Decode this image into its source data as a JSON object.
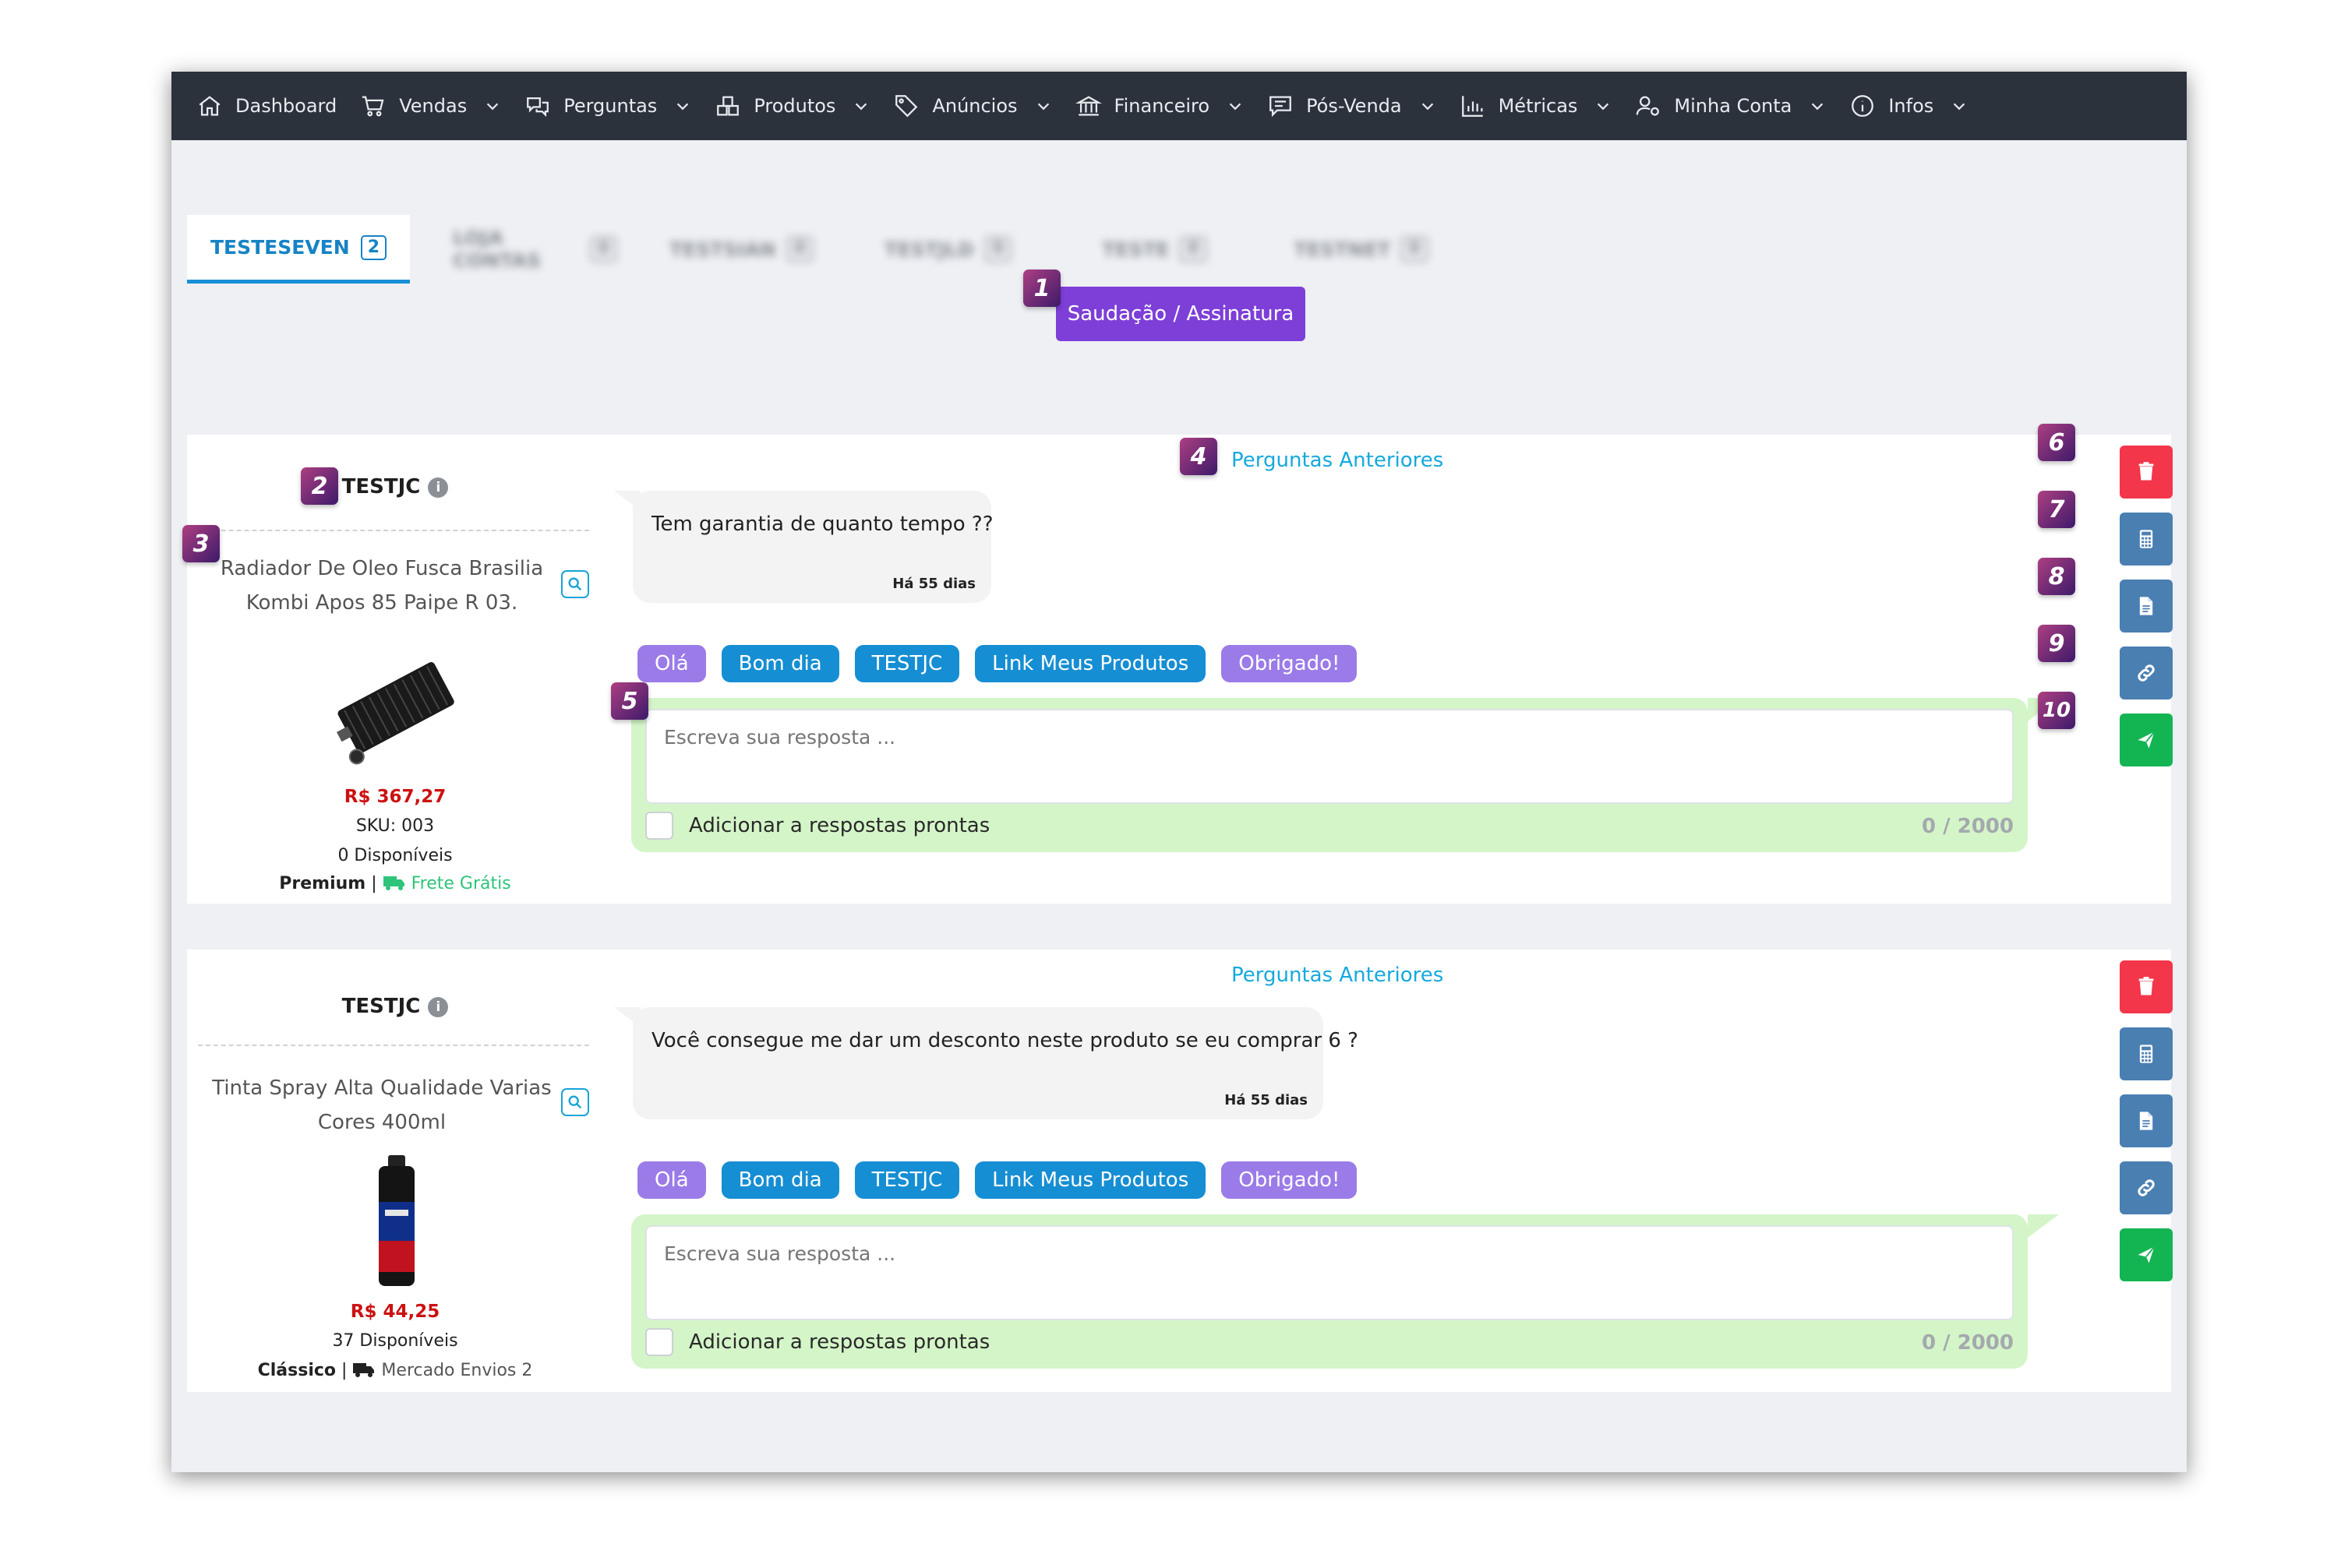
{
  "nav": [
    {
      "label": "Dashboard",
      "icon": "home-icon",
      "dropdown": false
    },
    {
      "label": "Vendas",
      "icon": "cart-icon",
      "dropdown": true
    },
    {
      "label": "Perguntas",
      "icon": "chat-icon",
      "dropdown": true
    },
    {
      "label": "Produtos",
      "icon": "boxes-icon",
      "dropdown": true
    },
    {
      "label": "Anúncios",
      "icon": "tag-icon",
      "dropdown": true
    },
    {
      "label": "Financeiro",
      "icon": "bank-icon",
      "dropdown": true
    },
    {
      "label": "Pós-Venda",
      "icon": "message-icon",
      "dropdown": true
    },
    {
      "label": "Métricas",
      "icon": "bar-chart-icon",
      "dropdown": true
    },
    {
      "label": "Minha Conta",
      "icon": "user-settings-icon",
      "dropdown": true
    },
    {
      "label": "Infos",
      "icon": "info-icon",
      "dropdown": true
    }
  ],
  "tabs": {
    "active": {
      "label": "TESTESEVEN",
      "count": "2"
    },
    "others": [
      {
        "label": "LOJA CONTAS",
        "count": "0"
      },
      {
        "label": "TESTSIAN",
        "count": "0"
      },
      {
        "label": "TESTJLD",
        "count": "0"
      },
      {
        "label": "TESTE",
        "count": "0"
      },
      {
        "label": "TESTNET",
        "count": "0"
      }
    ]
  },
  "greeting_button": "Saudação / Assinatura",
  "questions": [
    {
      "seller": "TESTJC",
      "product_title": "Radiador De Oleo Fusca Brasilia Kombi Apos 85 Paipe R 03.",
      "price": "R$ 367,27",
      "sku": "SKU: 003",
      "stock": "0 Disponíveis",
      "listing_type": "Premium",
      "shipping": "Frete Grátis",
      "previous_link": "Perguntas Anteriores",
      "question": "Tem garantia de quanto tempo ??",
      "time": "Há 55 dias",
      "reply_placeholder": "Escreva sua resposta ...",
      "add_ready_label": "Adicionar a respostas prontas",
      "counter": "0 / 2000"
    },
    {
      "seller": "TESTJC",
      "product_title": "Tinta Spray Alta Qualidade Varias Cores 400ml",
      "price": "R$ 44,25",
      "stock": "37 Disponíveis",
      "listing_type": "Clássico",
      "shipping": "Mercado Envios 2",
      "previous_link": "Perguntas Anteriores",
      "question": "Você consegue me dar um desconto neste produto se eu comprar 6 ?",
      "time": "Há 55 dias",
      "reply_placeholder": "Escreva sua resposta ...",
      "add_ready_label": "Adicionar a respostas prontas",
      "counter": "0 / 2000"
    }
  ],
  "quick_replies": [
    {
      "label": "Olá",
      "color": "#9b7be8"
    },
    {
      "label": "Bom dia",
      "color": "#168ed3"
    },
    {
      "label": "TESTJC",
      "color": "#168ed3"
    },
    {
      "label": "Link Meus Produtos",
      "color": "#168ed3"
    },
    {
      "label": "Obrigado!",
      "color": "#9b7be8"
    }
  ],
  "info_glyph": "i",
  "badges": [
    "1",
    "2",
    "3",
    "4",
    "5",
    "6",
    "7",
    "8",
    "9",
    "10"
  ],
  "colors": {
    "navbar": "#2b323c",
    "accent_blue": "#1683c5",
    "greeting_purple": "#7d3fd8",
    "delete_red": "#f3364a",
    "send_green": "#13b553",
    "reply_panel": "#d4f5c8",
    "price_red": "#cc1111"
  }
}
